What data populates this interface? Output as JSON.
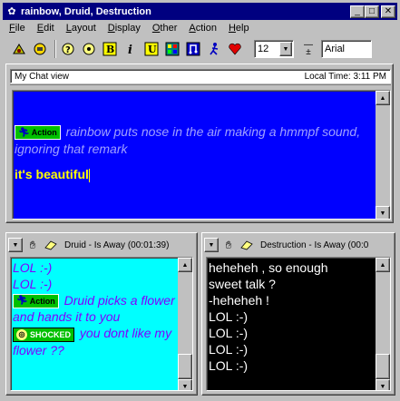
{
  "window": {
    "title": "rainbow, Druid, Destruction"
  },
  "menu": [
    "File",
    "Edit",
    "Layout",
    "Display",
    "Other",
    "Action",
    "Help"
  ],
  "toolbar": {
    "font_size": "12",
    "font_name": "Arial"
  },
  "main_chat": {
    "title": "My Chat view",
    "local_time": "Local Time: 3:11 PM",
    "action_badge": "Action",
    "action_text": "rainbow puts nose in the air making a hmmpf sound, ignoring that remark",
    "message": "it's beautiful"
  },
  "left_chat": {
    "header": "Druid - Is Away (00:01:39)",
    "lines": [
      "LOL :-)",
      "LOL :-)"
    ],
    "action_badge": "Action",
    "action_text": "Druid picks a flower and hands it to you",
    "shocked_badge": "SHOCKED",
    "shocked_text": "you dont like my flower ??"
  },
  "right_chat": {
    "header": "Destruction - Is Away (00:0",
    "lines": [
      "heheheh , so enough",
      "sweet talk ?",
      "-heheheh !",
      "LOL :-)",
      "LOL :-)",
      "LOL :-)",
      "LOL :-)"
    ]
  },
  "colors": {
    "main_bg": "#0000ff",
    "left_bg": "#00ffff",
    "right_bg": "#000000",
    "titlebar": "#000080"
  }
}
